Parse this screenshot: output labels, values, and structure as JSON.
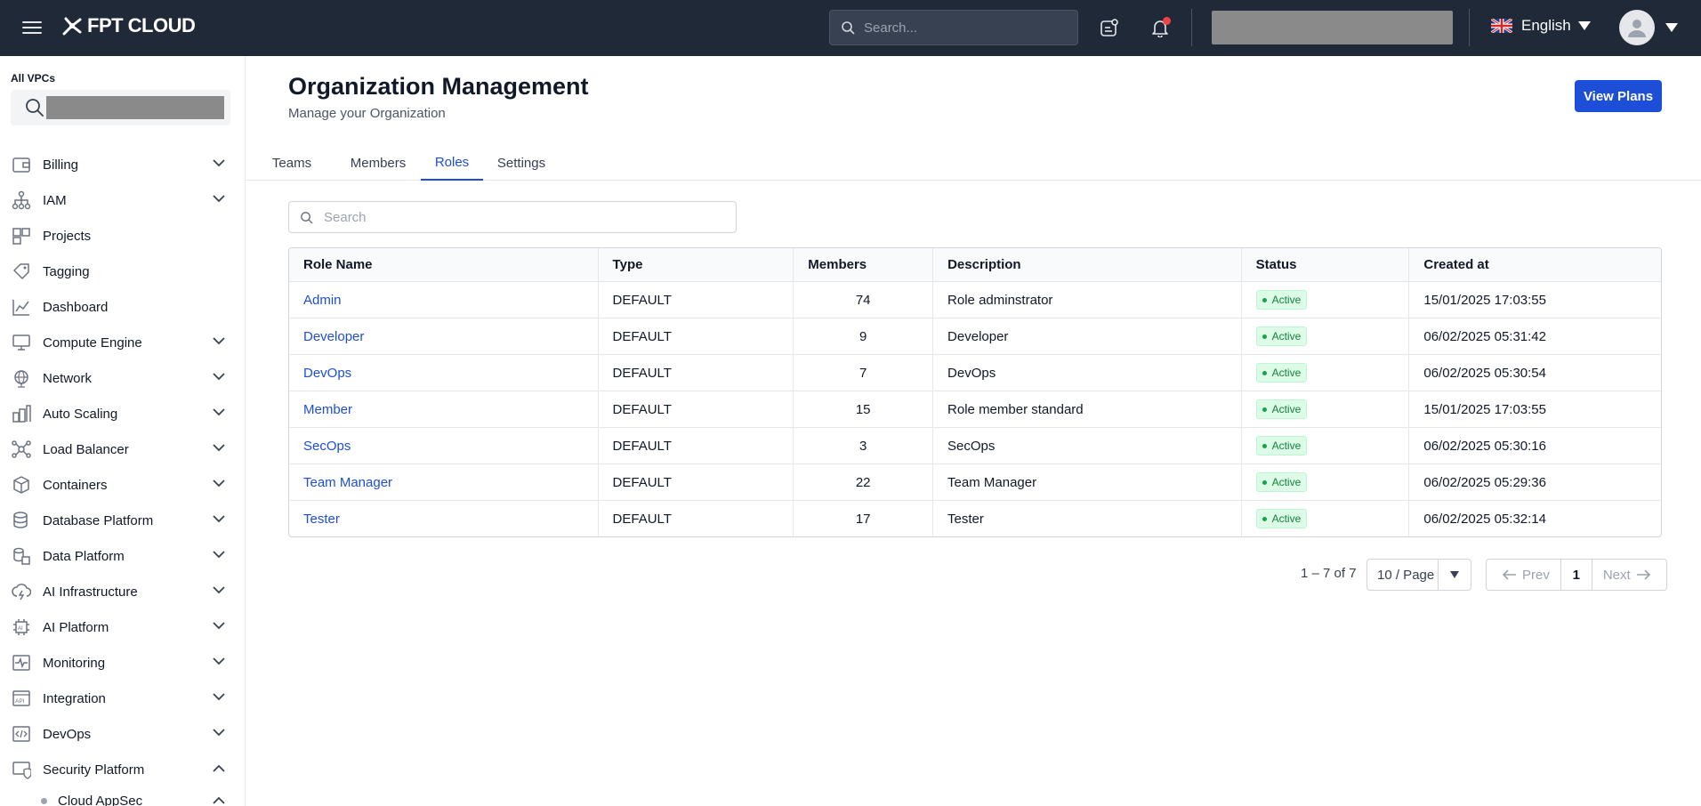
{
  "header": {
    "brand": "FPT CLOUD",
    "search_placeholder": "Search...",
    "language": "English",
    "menu_icon": "hamburger-icon",
    "notification_indicator_color": "#ef4444"
  },
  "sidebar": {
    "vpc_label": "All VPCs",
    "items": [
      {
        "label": "Billing",
        "icon": "wallet-icon",
        "expandable": true
      },
      {
        "label": "IAM",
        "icon": "hierarchy-icon",
        "expandable": true
      },
      {
        "label": "Projects",
        "icon": "projects-icon",
        "expandable": false
      },
      {
        "label": "Tagging",
        "icon": "tag-icon",
        "expandable": false
      },
      {
        "label": "Dashboard",
        "icon": "chart-icon",
        "expandable": false
      },
      {
        "label": "Compute Engine",
        "icon": "monitor-icon",
        "expandable": true
      },
      {
        "label": "Network",
        "icon": "globe-icon",
        "expandable": true
      },
      {
        "label": "Auto Scaling",
        "icon": "scaling-icon",
        "expandable": true
      },
      {
        "label": "Load Balancer",
        "icon": "balancer-icon",
        "expandable": true
      },
      {
        "label": "Containers",
        "icon": "cube-icon",
        "expandable": true
      },
      {
        "label": "Database Platform",
        "icon": "database-icon",
        "expandable": true
      },
      {
        "label": "Data Platform",
        "icon": "data-icon",
        "expandable": true
      },
      {
        "label": "AI Infrastructure",
        "icon": "cloud-bolt-icon",
        "expandable": true
      },
      {
        "label": "AI Platform",
        "icon": "chip-icon",
        "expandable": true
      },
      {
        "label": "Monitoring",
        "icon": "pulse-icon",
        "expandable": true
      },
      {
        "label": "Integration",
        "icon": "api-icon",
        "expandable": true
      },
      {
        "label": "DevOps",
        "icon": "code-icon",
        "expandable": true
      },
      {
        "label": "Security Platform",
        "icon": "shield-monitor-icon",
        "expandable": true,
        "expanded": true
      }
    ],
    "sub_items": [
      {
        "label": "Cloud AppSec"
      }
    ]
  },
  "page": {
    "title": "Organization Management",
    "subtitle": "Manage your Organization",
    "view_plans": "View Plans"
  },
  "tabs": [
    {
      "label": "Teams",
      "active": false
    },
    {
      "label": "Members",
      "active": false
    },
    {
      "label": "Roles",
      "active": true
    },
    {
      "label": "Settings",
      "active": false
    }
  ],
  "table": {
    "search_placeholder": "Search",
    "columns": [
      "Role Name",
      "Type",
      "Members",
      "Description",
      "Status",
      "Created at"
    ],
    "rows": [
      {
        "name": "Admin",
        "type": "DEFAULT",
        "members": "74",
        "description": "Role adminstrator",
        "status": "Active",
        "created": "15/01/2025 17:03:55"
      },
      {
        "name": "Developer",
        "type": "DEFAULT",
        "members": "9",
        "description": "Developer",
        "status": "Active",
        "created": "06/02/2025 05:31:42"
      },
      {
        "name": "DevOps",
        "type": "DEFAULT",
        "members": "7",
        "description": "DevOps",
        "status": "Active",
        "created": "06/02/2025 05:30:54"
      },
      {
        "name": "Member",
        "type": "DEFAULT",
        "members": "15",
        "description": "Role member standard",
        "status": "Active",
        "created": "15/01/2025 17:03:55"
      },
      {
        "name": "SecOps",
        "type": "DEFAULT",
        "members": "3",
        "description": "SecOps",
        "status": "Active",
        "created": "06/02/2025 05:30:16"
      },
      {
        "name": "Team Manager",
        "type": "DEFAULT",
        "members": "22",
        "description": "Team Manager",
        "status": "Active",
        "created": "06/02/2025 05:29:36"
      },
      {
        "name": "Tester",
        "type": "DEFAULT",
        "members": "17",
        "description": "Tester",
        "status": "Active",
        "created": "06/02/2025 05:32:14"
      }
    ]
  },
  "pagination": {
    "range": "1 – 7 of 7",
    "page_size": "10 / Page",
    "prev": "Prev",
    "current": "1",
    "next": "Next"
  },
  "colors": {
    "accent": "#1d4ed8",
    "topbar": "#1f2937",
    "status_active_bg": "#dcfce7",
    "status_active_text": "#15803d"
  }
}
